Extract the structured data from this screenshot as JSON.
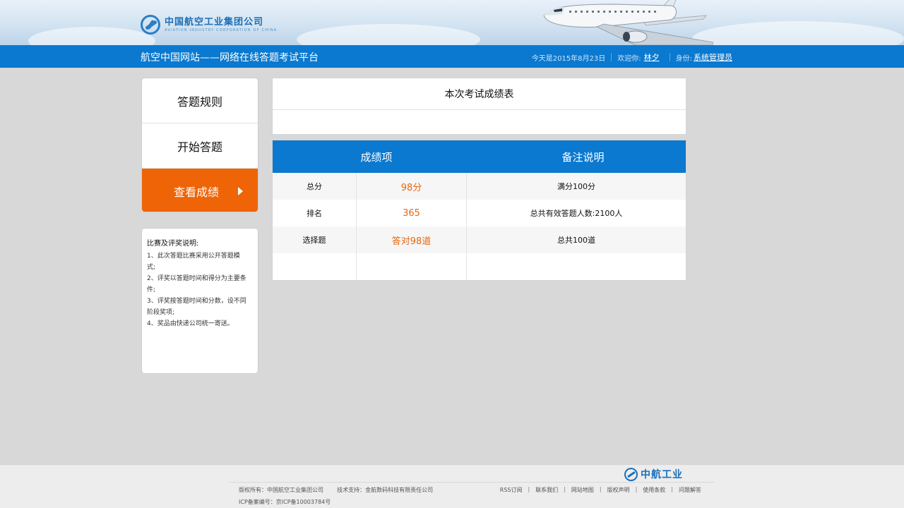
{
  "header": {
    "logo_cn": "中国航空工业集团公司",
    "logo_en": "AVIATION INDUSTRY CORPORATION OF CHINA",
    "site_title": "航空中国网站——网络在线答题考试平台",
    "date_text": "今天是2015年8月23日",
    "welcome_label": "欢迎你:",
    "user_name": "林夕",
    "role_label": "身份:",
    "role_value": "系统管理员"
  },
  "sidebar": {
    "menu": [
      {
        "label": "答题规则",
        "active": false
      },
      {
        "label": "开始答题",
        "active": false
      },
      {
        "label": "查看成绩",
        "active": true
      }
    ],
    "rules": {
      "title": "比赛及评奖说明:",
      "lines": [
        "1、此次答题比赛采用公开答题模",
        "式;",
        "2、评奖以答题时间和得分为主要条",
        "件;",
        "3、评奖按答题时间和分数，设不同",
        "阶段奖项;",
        "4、奖品由快递公司统一寄送。"
      ]
    }
  },
  "main": {
    "title": "本次考试成绩表",
    "table": {
      "headers": [
        "成绩项",
        "备注说明"
      ],
      "rows": [
        {
          "item": "总分",
          "value": "98分",
          "note": "满分100分"
        },
        {
          "item": "排名",
          "value": "365",
          "note": "总共有效答题人数:2100人"
        },
        {
          "item": "选择题",
          "value": "答对98道",
          "note": "总共100道"
        },
        {
          "item": "",
          "value": "",
          "note": ""
        }
      ]
    }
  },
  "footer": {
    "logo_text": "中航工业",
    "copyright": "版权所有：中国航空工业集团公司",
    "support": "技术支持：金航数码科技有限责任公司",
    "icp": "ICP备案编号：京ICP备10003784号",
    "links": [
      "RSS订阅",
      "联系我们",
      "网站地图",
      "版权声明",
      "使用条款",
      "问题解答"
    ]
  },
  "colors": {
    "nav_blue": "#0a79cf",
    "active_orange": "#ee6407",
    "value_orange": "#e8670f",
    "background": "#d8d8d8"
  }
}
